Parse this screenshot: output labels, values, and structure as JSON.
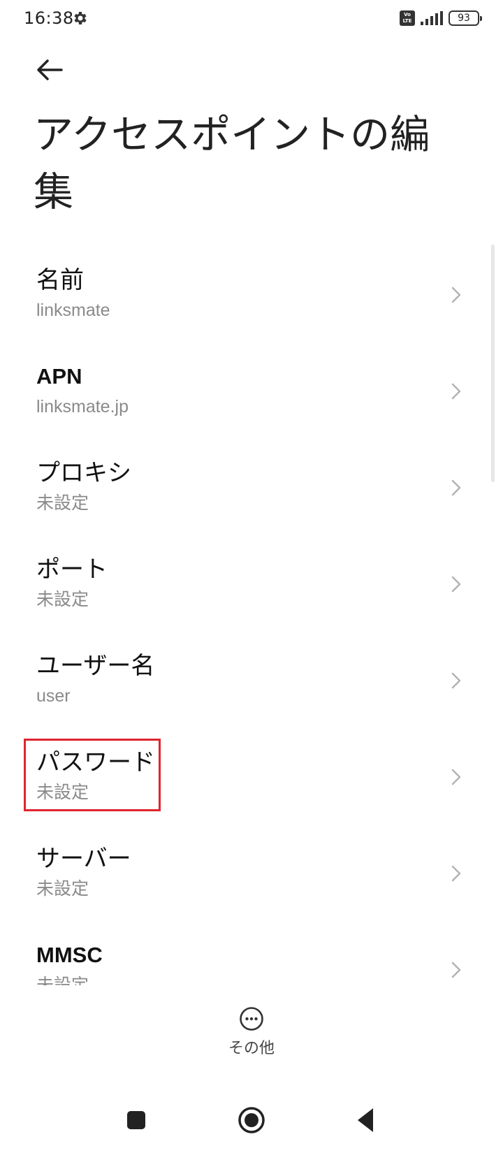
{
  "status_bar": {
    "time": "16:38",
    "volte_label": "Vo LTE",
    "battery": "93",
    "icons": [
      "gear-icon",
      "volte-icon",
      "signal-icon",
      "battery-icon"
    ]
  },
  "header": {
    "back_icon": "arrow-left-icon",
    "title": "アクセスポイントの編集"
  },
  "settings": {
    "items": [
      {
        "label": "名前",
        "value": "linksmate"
      },
      {
        "label": "APN",
        "value": "linksmate.jp"
      },
      {
        "label": "プロキシ",
        "value": "未設定"
      },
      {
        "label": "ポート",
        "value": "未設定"
      },
      {
        "label": "ユーザー名",
        "value": "user"
      },
      {
        "label": "パスワード",
        "value": "未設定"
      },
      {
        "label": "サーバー",
        "value": "未設定"
      },
      {
        "label": "MMSC",
        "value": "未設定"
      }
    ],
    "highlighted_item": "パスワード",
    "highlight_color": "#e0242e"
  },
  "footer": {
    "more_label": "その他",
    "more_icon": "more-horizontal-circle-icon"
  },
  "nav_bar": {
    "icons": [
      "recents-square-icon",
      "home-circle-icon",
      "back-triangle-icon"
    ]
  }
}
